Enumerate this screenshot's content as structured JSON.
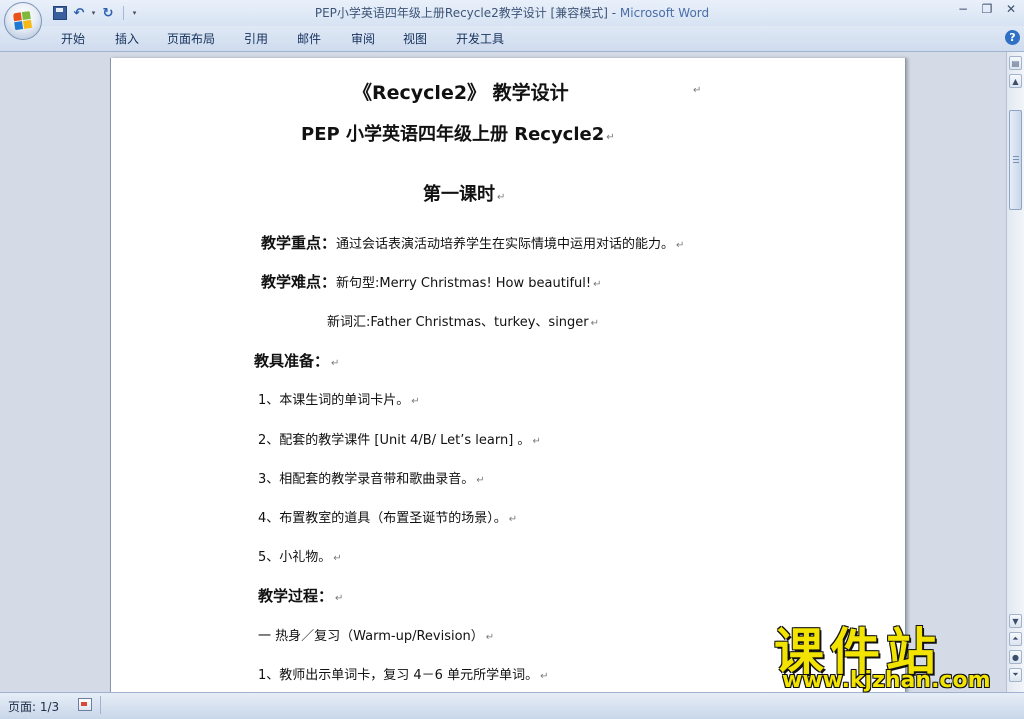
{
  "window": {
    "title_doc": "PEP小学英语四年级上册Recycle2教学设计 [兼容模式] - ",
    "title_app": "Microsoft Word",
    "min_glyph": "−",
    "restore_glyph": "❐",
    "close_glyph": "✕"
  },
  "quick_access": {
    "dropdown_glyph": "▾",
    "customize_glyph": "▾",
    "undo_glyph": "↶",
    "redo_glyph": "↻"
  },
  "ribbon": {
    "tabs": [
      "开始",
      "插入",
      "页面布局",
      "引用",
      "邮件",
      "审阅",
      "视图",
      "开发工具"
    ],
    "help_label": "?"
  },
  "document": {
    "title": "《Recycle2》  教学设计",
    "subtitle": "PEP 小学英语四年级上册 Recycle2",
    "section": "第一课时",
    "focus_label": "教学重点：",
    "focus_text": "通过会话表演活动培养学生在实际情境中运用对话的能力。",
    "difficulty_label": "教学难点：",
    "difficulty_text": "新句型:Merry Christmas! How beautiful!",
    "new_words": "新词汇:Father Christmas、turkey、singer",
    "prep_label": "教具准备：",
    "prep_items": [
      "1、本课生词的单词卡片。",
      "2、配套的教学课件  [Unit 4/B/ Let’s learn]  。",
      "3、相配套的教学录音带和歌曲录音。",
      "4、布置教室的道具（布置圣诞节的场景）。",
      "5、小礼物。"
    ],
    "process_label": "教学过程：",
    "process_items": [
      "一  热身／复习（Warm-up/Revision）",
      "1、教师出示单词卡，复习 4－6 单元所学单词。"
    ],
    "paragraph_mark": "↵"
  },
  "statusbar": {
    "page_info": "页面: 1/3"
  },
  "watermark": {
    "logo_text": "课件站",
    "url_text": "www.kjzhan.com"
  },
  "colors": {
    "watermark_yellow": "#f2e300",
    "title_app_blue": "#4a6ea8"
  }
}
